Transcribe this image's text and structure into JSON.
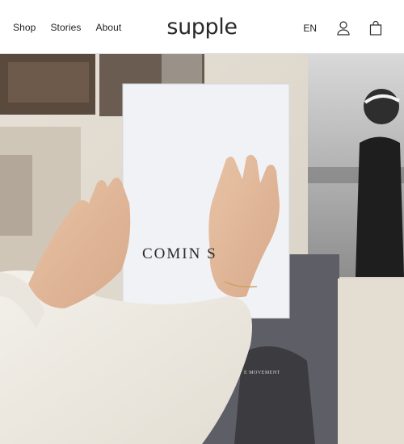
{
  "header": {
    "nav": [
      {
        "label": "Shop"
      },
      {
        "label": "Stories"
      },
      {
        "label": "About"
      }
    ],
    "logo": "supple",
    "language": "EN",
    "icons": {
      "account": "user-icon",
      "cart": "shopping-bag-icon"
    }
  },
  "hero": {
    "pad_text": "COMIN  S",
    "print_text": "E MOVEMENT"
  },
  "colors": {
    "header_bg": "#ffffff",
    "header_border": "#d9d9d9",
    "text": "#1f1f1f"
  }
}
